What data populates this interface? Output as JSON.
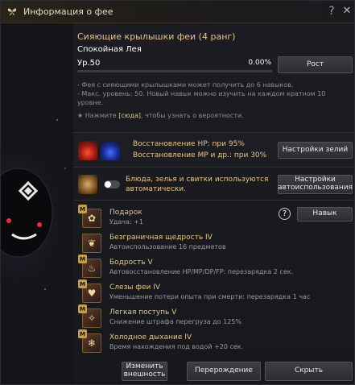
{
  "window": {
    "title": "Информация о фее"
  },
  "header": {
    "fairy_type": "Сияющие крылышки феи (4 ранг)",
    "fairy_name": "Спокойная Лея",
    "level": "Ур.50",
    "level_progress": "0.00%",
    "level_fraction": 0.0,
    "grow_button": "Рост"
  },
  "notes": {
    "line1": "- Фея с сияющими крылышками может получить до 6 навыков.",
    "line2": "- Макс. уровень: 50. Новый навык можно изучить на каждом кратном 10 уровне.",
    "line3_prefix": "★ Нажмите ",
    "line3_link": "[сюда]",
    "line3_suffix": ", чтобы узнать о вероятности."
  },
  "potions": {
    "hp_text": "Восстановление HP: при 95%",
    "mp_text": "Восстановление MP и др.: при 30%",
    "settings_button": "Настройки зелий"
  },
  "auto_use": {
    "text": "Блюда, зелья и свитки используются автоматически.",
    "toggle_on": false,
    "settings_button": "Настройки автоиспользования"
  },
  "skills": {
    "skill_button": "Навык",
    "items": [
      {
        "badge": "M",
        "icon": "gift-icon",
        "name": "Подарок",
        "desc": "Удача: +1"
      },
      {
        "badge": "",
        "icon": "wing-icon",
        "name": "Безграничная щедрость IV",
        "desc": "Автоиспользование 16 предметов"
      },
      {
        "badge": "M",
        "icon": "potion-icon",
        "name": "Бодрость V",
        "desc": "Автовосстановление HP/MP/DP/FP: перезарядка 2 сек."
      },
      {
        "badge": "M",
        "icon": "tear-icon",
        "name": "Слезы феи IV",
        "desc": "Уменьшение потери опыта при смерти: перезарядка 1 час"
      },
      {
        "badge": "M",
        "icon": "feather-icon",
        "name": "Легкая поступь V",
        "desc": "Снижение штрафа перегруза до 125%"
      },
      {
        "badge": "M",
        "icon": "breath-icon",
        "name": "Холодное дыхание IV",
        "desc": "Время нахождения под водой +20 сек."
      }
    ]
  },
  "footer": {
    "change_appearance": "Изменить внешность",
    "rebirth": "Перерождение",
    "hide": "Скрыть"
  },
  "colors": {
    "accent_gold": "#e5c68a",
    "text_white": "#ffffff",
    "text_gray": "#9a9a9a"
  }
}
